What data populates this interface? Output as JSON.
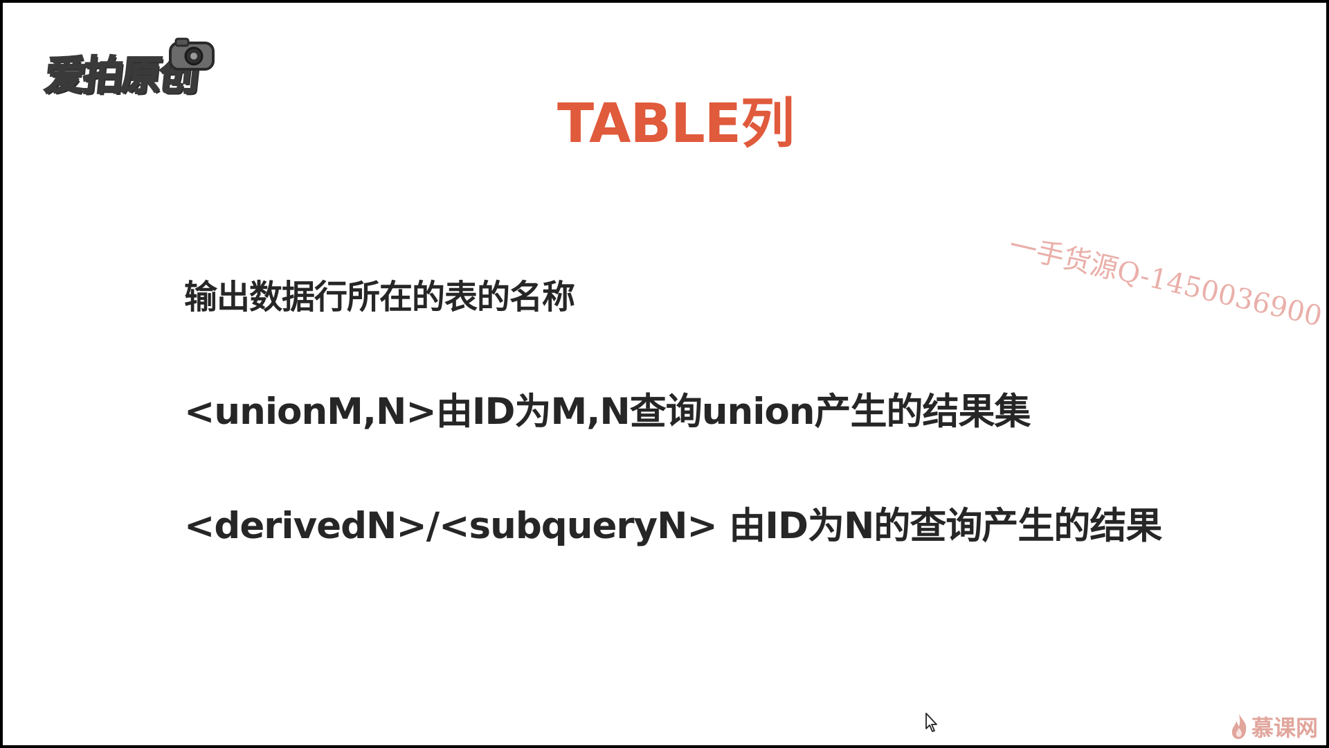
{
  "slide": {
    "logo_text": "爱拍原创",
    "title": "TABLE列",
    "lines": [
      "输出数据行所在的表的名称",
      "<unionM,N>由ID为M,N查询union产生的结果集",
      "<derivedN>/<subqueryN> 由ID为N的查询产生的结果"
    ],
    "watermark": "一手货源Q-1450036900",
    "brand": "慕课网"
  },
  "colors": {
    "title": "#e05a3c",
    "body_text": "#262626",
    "watermark": "#e8a7a0",
    "background": "#ffffff",
    "border": "#000000"
  },
  "icons": {
    "logo_camera": "camera-icon",
    "brand_flame": "flame-icon",
    "cursor": "mouse-pointer-icon"
  }
}
